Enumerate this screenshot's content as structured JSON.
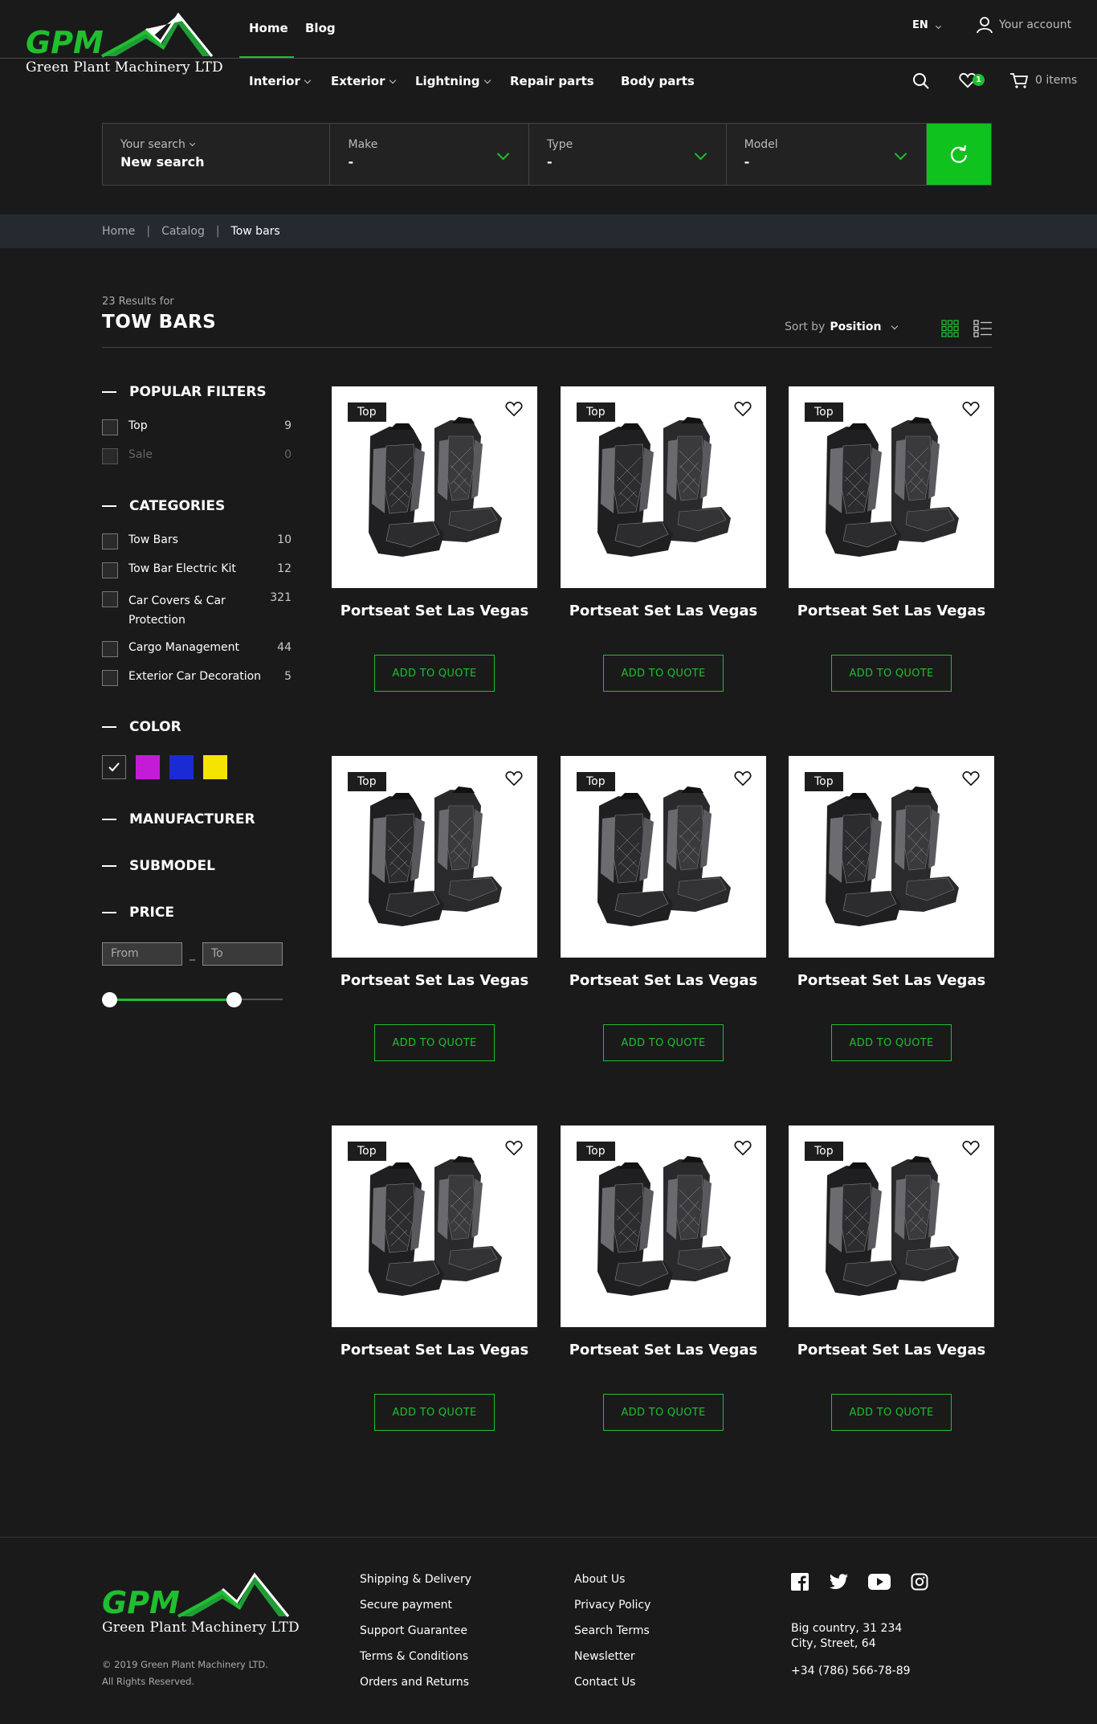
{
  "brand": {
    "logo_mark": "GPM",
    "name": "Green Plant Machinery LTD"
  },
  "top_nav": [
    {
      "label": "Home"
    },
    {
      "label": "Blog"
    }
  ],
  "language": "EN",
  "account_label": "Your account",
  "main_menu": [
    {
      "label": "Interior"
    },
    {
      "label": "Exterior"
    },
    {
      "label": "Lightning"
    },
    {
      "label": "Repair parts"
    },
    {
      "label": "Body parts"
    }
  ],
  "wishlist_count": "1",
  "cart_label": "0 items",
  "search": {
    "your_search_label": "Your search",
    "your_search_value": "New search",
    "make_label": "Make",
    "make_value": "-",
    "type_label": "Type",
    "type_value": "-",
    "model_label": "Model",
    "model_value": "-"
  },
  "breadcrumb": [
    "Home",
    "Catalog",
    "Tow bars"
  ],
  "results_text": "23 Results for",
  "page_title": "TOW BARS",
  "sort": {
    "label": "Sort by",
    "value": "Position"
  },
  "filters": {
    "popular": {
      "title": "POPULAR FILTERS",
      "items": [
        {
          "label": "Top",
          "count": "9"
        },
        {
          "label": "Sale",
          "count": "0"
        }
      ]
    },
    "categories": {
      "title": "CATEGORIES",
      "items": [
        {
          "label": "Tow Bars",
          "count": "10"
        },
        {
          "label": "Tow Bar Electric Kit",
          "count": "12"
        },
        {
          "label": "Car Covers & Car",
          "label2": "Protection",
          "count": "321"
        },
        {
          "label": "Cargo Management",
          "count": "44"
        },
        {
          "label": "Exterior Car Decoration",
          "count": "5"
        }
      ]
    },
    "color": {
      "title": "COLOR",
      "swatches": [
        "#202020",
        "#c41cd6",
        "#1a2bd6",
        "#f5e400"
      ]
    },
    "manufacturer": {
      "title": "MANUFACTURER"
    },
    "submodel": {
      "title": "SUBMODEL"
    },
    "price": {
      "title": "PRICE",
      "from_placeholder": "From",
      "to_placeholder": "To"
    }
  },
  "products": [
    {
      "tag": "Top",
      "title": "Portseat Set Las Vegas",
      "button": "ADD TO QUOTE"
    },
    {
      "tag": "Top",
      "title": "Portseat Set Las Vegas",
      "button": "ADD TO QUOTE"
    },
    {
      "tag": "Top",
      "title": "Portseat Set Las Vegas",
      "button": "ADD TO QUOTE"
    },
    {
      "tag": "Top",
      "title": "Portseat Set Las Vegas",
      "button": "ADD TO QUOTE"
    },
    {
      "tag": "Top",
      "title": "Portseat Set Las Vegas",
      "button": "ADD TO QUOTE"
    },
    {
      "tag": "Top",
      "title": "Portseat Set Las Vegas",
      "button": "ADD TO QUOTE"
    },
    {
      "tag": "Top",
      "title": "Portseat Set Las Vegas",
      "button": "ADD TO QUOTE"
    },
    {
      "tag": "Top",
      "title": "Portseat Set Las Vegas",
      "button": "ADD TO QUOTE"
    },
    {
      "tag": "Top",
      "title": "Portseat Set Las Vegas",
      "button": "ADD TO QUOTE"
    }
  ],
  "footer": {
    "copyright_line1": "© 2019 Green Plant Machinery LTD.",
    "copyright_line2": "All Rights Reserved.",
    "links_col1": [
      "Shipping & Delivery",
      "Secure payment",
      "Support Guarantee",
      "Terms & Conditions",
      "Orders and Returns"
    ],
    "links_col2": [
      "About Us",
      "Privacy Policy",
      "Search Terms",
      "Newsletter",
      "Contact Us"
    ],
    "social_icons": [
      "facebook-icon",
      "twitter-icon",
      "youtube-icon",
      "instagram-icon"
    ],
    "address_line1": "Big country, 31 234",
    "address_line2": "City, Street, 64",
    "phone": "+34 (786) 566-78-89"
  },
  "colors": {
    "accent": "#1fbf2f",
    "background": "#1a1a1b",
    "breadcrumb_bar": "#252a30"
  }
}
